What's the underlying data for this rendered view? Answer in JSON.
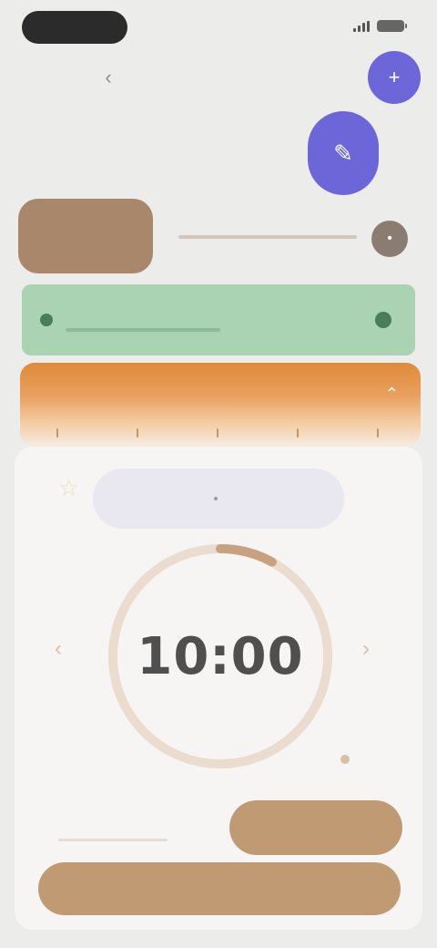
{
  "status_bar": {
    "time": "",
    "icons": [
      "signal-icon",
      "battery-icon"
    ]
  },
  "nav": {
    "back_icon": "chevron-left-icon",
    "title": ""
  },
  "fabs": {
    "small_icon": "plus-icon",
    "large_icon": "pencil-icon"
  },
  "tabs": {
    "active_label": "",
    "trailing_icon": "dot-icon"
  },
  "banner": {
    "label": ""
  },
  "timer": {
    "mode_title": "",
    "value": "10:00",
    "progress": 0.08,
    "sound_label": "",
    "sound_button_label": "",
    "start_button_label": ""
  },
  "colors": {
    "accent_purple": "#6d66d8",
    "accent_brown": "#a8876a",
    "button_tan": "#c09a73",
    "banner_green": "#a9d3b3",
    "card_orange": "#e08a3a",
    "ring": "#eadcce",
    "ring_progress": "#c8a27e"
  }
}
